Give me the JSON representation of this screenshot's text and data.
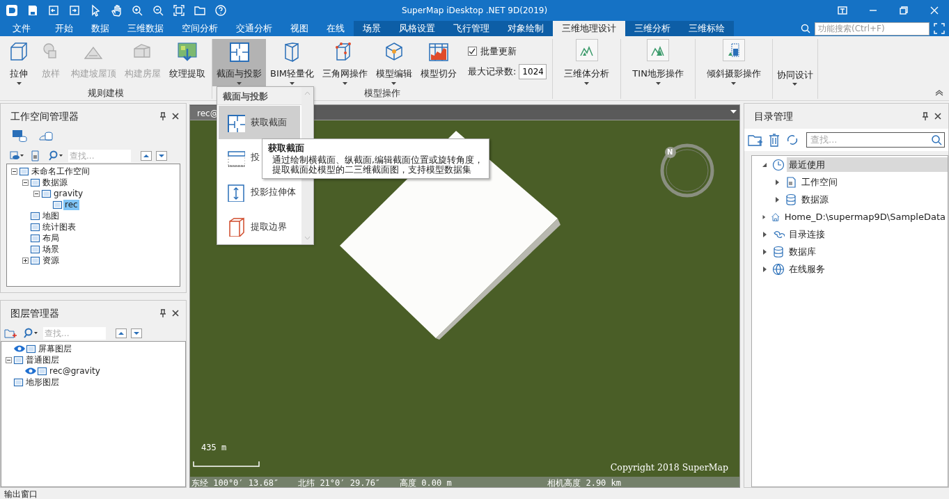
{
  "window": {
    "title": "SuperMap iDesktop .NET 9D(2019)"
  },
  "menu_tabs": [
    {
      "label": "文件",
      "selected": false,
      "contextual": false
    },
    {
      "label": "开始",
      "selected": false,
      "contextual": false
    },
    {
      "label": "数据",
      "selected": false,
      "contextual": false
    },
    {
      "label": "三维数据",
      "selected": false,
      "contextual": false
    },
    {
      "label": "空间分析",
      "selected": false,
      "contextual": false
    },
    {
      "label": "交通分析",
      "selected": false,
      "contextual": false
    },
    {
      "label": "视图",
      "selected": false,
      "contextual": false
    },
    {
      "label": "在线",
      "selected": false,
      "contextual": false
    },
    {
      "label": "场景",
      "selected": false,
      "contextual": true
    },
    {
      "label": "风格设置",
      "selected": false,
      "contextual": true
    },
    {
      "label": "飞行管理",
      "selected": false,
      "contextual": true
    },
    {
      "label": "对象绘制",
      "selected": false,
      "contextual": true
    },
    {
      "label": "三维地理设计",
      "selected": true,
      "contextual": true
    },
    {
      "label": "三维分析",
      "selected": false,
      "contextual": true
    },
    {
      "label": "三维标绘",
      "selected": false,
      "contextual": true
    }
  ],
  "feature_search": {
    "placeholder": "功能搜索(Ctrl+F)"
  },
  "ribbon": {
    "groups": [
      {
        "label": "规则建模",
        "items": [
          {
            "kind": "large",
            "label": "拉伸",
            "disabled": false,
            "pressed": false,
            "dropdown": true
          },
          {
            "kind": "large",
            "label": "放样",
            "disabled": true,
            "pressed": false,
            "dropdown": false
          },
          {
            "kind": "large",
            "label": "构建坡屋顶",
            "disabled": true,
            "pressed": false,
            "dropdown": false
          },
          {
            "kind": "large",
            "label": "构建房屋",
            "disabled": true,
            "pressed": false,
            "dropdown": false
          },
          {
            "kind": "large",
            "label": "纹理提取",
            "disabled": false,
            "pressed": false,
            "dropdown": false
          }
        ]
      },
      {
        "label": "模型操作",
        "items": [
          {
            "kind": "large",
            "label": "截面与投影",
            "disabled": false,
            "pressed": true,
            "dropdown": true
          },
          {
            "kind": "large",
            "label": "BIM轻量化",
            "disabled": false,
            "pressed": false,
            "dropdown": true
          },
          {
            "kind": "large",
            "label": "三角网操作",
            "disabled": false,
            "pressed": false,
            "dropdown": true
          },
          {
            "kind": "large",
            "label": "模型编辑",
            "disabled": false,
            "pressed": false,
            "dropdown": true
          },
          {
            "kind": "large",
            "label": "模型切分",
            "disabled": false,
            "pressed": false,
            "dropdown": false
          }
        ],
        "options": {
          "checkbox": {
            "label": "批量更新",
            "checked": true
          },
          "field": {
            "label": "最大记录数:",
            "value": "1024"
          }
        }
      },
      {
        "items": [
          {
            "kind": "framed",
            "label": "三维体分析",
            "disabled": false,
            "pressed": false,
            "dropdown": true
          }
        ]
      },
      {
        "items": [
          {
            "kind": "framed",
            "label": "TIN地形操作",
            "disabled": false,
            "pressed": false,
            "dropdown": true
          }
        ]
      },
      {
        "items": [
          {
            "kind": "framed",
            "label": "倾斜摄影操作",
            "disabled": false,
            "pressed": false,
            "dropdown": true
          }
        ]
      },
      {
        "items": [
          {
            "kind": "plain",
            "label": "协同设计",
            "disabled": false,
            "pressed": false,
            "dropdown": true
          }
        ]
      }
    ]
  },
  "dropdown_menu": {
    "title": "截面与投影",
    "items": [
      {
        "label": "获取截面",
        "selected": true
      },
      {
        "label": "投",
        "selected": false
      },
      {
        "label": "投影拉伸体",
        "selected": false
      },
      {
        "label": "提取边界",
        "selected": false
      }
    ]
  },
  "tooltip": {
    "title": "获取截面",
    "lines": [
      "通过绘制横截面、纵截面,编辑截面位置或旋转角度，",
      "提取截面处模型的二三维截面图，支持模型数据集"
    ]
  },
  "workspace_manager": {
    "title": "工作空间管理器",
    "search": {
      "placeholder": "查找..."
    },
    "tree": [
      {
        "label": "未命名工作空间",
        "expanded": true,
        "selected": false,
        "children": [
          {
            "label": "数据源",
            "expanded": true,
            "selected": false,
            "children": [
              {
                "label": "gravity",
                "expanded": true,
                "selected": false,
                "children": [
                  {
                    "label": "rec",
                    "selected": true
                  }
                ]
              }
            ]
          },
          {
            "label": "地图",
            "selected": false
          },
          {
            "label": "统计图表",
            "selected": false
          },
          {
            "label": "布局",
            "selected": false
          },
          {
            "label": "场景",
            "selected": false
          },
          {
            "label": "资源",
            "expanded": false,
            "selected": false
          }
        ]
      }
    ]
  },
  "layer_manager": {
    "title": "图层管理器",
    "search": {
      "placeholder": "查找..."
    },
    "tree": [
      {
        "label": "屏幕图层",
        "visible": true
      },
      {
        "label": "普通图层",
        "visible": false,
        "expanded": true,
        "children": [
          {
            "label": "rec@gravity",
            "visible": true
          }
        ]
      },
      {
        "label": "地形图层",
        "visible": false
      }
    ]
  },
  "scene_view": {
    "tab": "rec@",
    "compass_label": "N",
    "scale": "435 m",
    "copyright": "Copyright 2018 SuperMap",
    "status": [
      "东经 100°0′ 13.68″",
      "北纬 21°0′ 29.76″",
      "高度 0.00 m",
      "相机高度 2.90 km"
    ]
  },
  "catalog_manager": {
    "title": "目录管理",
    "search": {
      "placeholder": "查找..."
    },
    "tree": [
      {
        "label": "最近使用",
        "expanded": true,
        "selected": true,
        "children": [
          {
            "label": "工作空间",
            "expanded": false,
            "selected": false
          },
          {
            "label": "数据源",
            "expanded": false,
            "selected": false
          }
        ]
      },
      {
        "label": "Home_D:\\supermap9D\\SampleData",
        "expanded": false,
        "selected": false
      },
      {
        "label": "目录连接",
        "expanded": false,
        "selected": false
      },
      {
        "label": "数据库",
        "expanded": false,
        "selected": false
      },
      {
        "label": "在线服务",
        "expanded": false,
        "selected": false
      }
    ]
  },
  "output_window": {
    "title": "输出窗口"
  }
}
